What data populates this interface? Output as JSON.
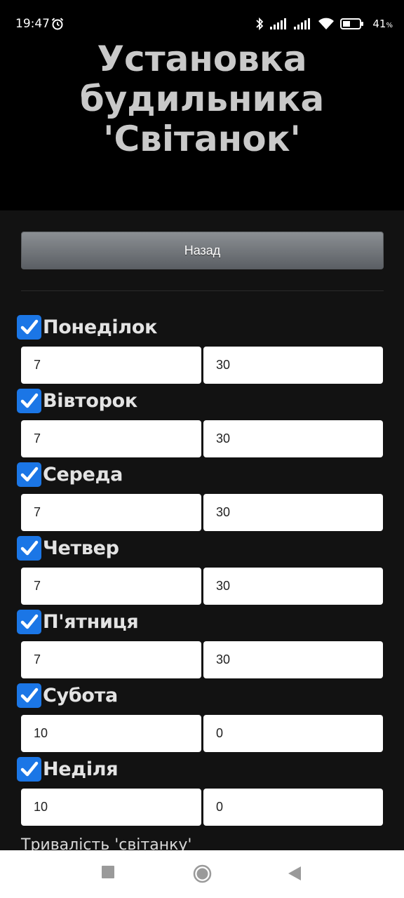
{
  "status": {
    "time": "19:47",
    "battery": "41",
    "battery_unit": "%"
  },
  "header": {
    "title_lines": [
      "Установка",
      "будильника",
      "'Світанок'"
    ]
  },
  "back_label": "Назад",
  "days": [
    {
      "label": "Понеділок",
      "checked": true,
      "hour": "7",
      "minute": "30"
    },
    {
      "label": "Вівторок",
      "checked": true,
      "hour": "7",
      "minute": "30"
    },
    {
      "label": "Середа",
      "checked": true,
      "hour": "7",
      "minute": "30"
    },
    {
      "label": "Четвер",
      "checked": true,
      "hour": "7",
      "minute": "30"
    },
    {
      "label": "П'ятниця",
      "checked": true,
      "hour": "7",
      "minute": "30"
    },
    {
      "label": "Субота",
      "checked": true,
      "hour": "10",
      "minute": "0"
    },
    {
      "label": "Неділя",
      "checked": true,
      "hour": "10",
      "minute": "0"
    }
  ],
  "duration_label": "Тривалість 'світанку'",
  "colors": {
    "checkbox": "#1b76e6",
    "content_bg": "#121212",
    "header_bg": "#000000"
  },
  "icons": {
    "alarm": "alarm-clock-icon",
    "bluetooth": "bluetooth-icon",
    "signal": "signal-icon",
    "wifi": "wifi-icon",
    "battery": "battery-icon",
    "checkmark": "checkmark-icon",
    "nav_recents": "square-icon",
    "nav_home": "circle-icon",
    "nav_back": "triangle-back-icon"
  }
}
